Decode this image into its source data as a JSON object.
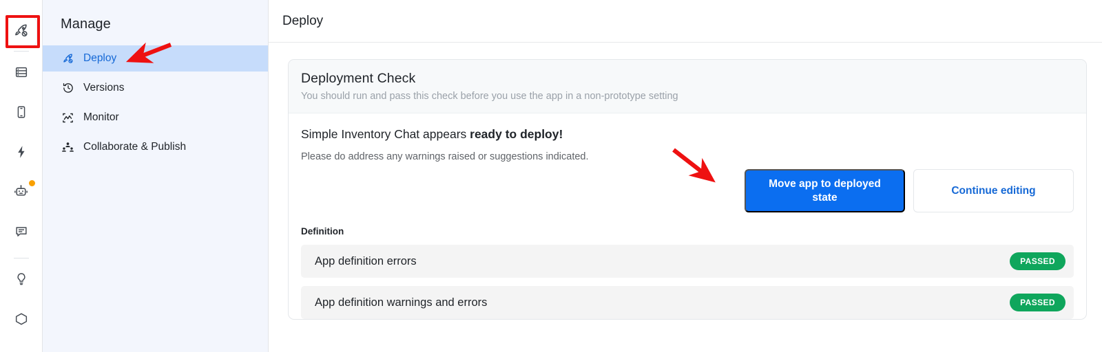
{
  "icon_rail": {
    "items": [
      {
        "name": "rocket-icon",
        "label": "Deploy",
        "active": true,
        "badge": false
      },
      {
        "name": "database-icon",
        "label": "Data",
        "active": false,
        "badge": false
      },
      {
        "name": "mobile-icon",
        "label": "Preview",
        "active": false,
        "badge": false
      },
      {
        "name": "lightning-icon",
        "label": "Automations",
        "active": false,
        "badge": false
      },
      {
        "name": "robot-icon",
        "label": "Assistant",
        "active": false,
        "badge": true
      },
      {
        "name": "chat-icon",
        "label": "Chat",
        "active": false,
        "badge": false
      },
      {
        "name": "lightbulb-icon",
        "label": "Ideas",
        "active": false,
        "badge": false
      }
    ]
  },
  "sidebar": {
    "title": "Manage",
    "items": [
      {
        "label": "Deploy",
        "icon": "rocket-icon",
        "selected": true
      },
      {
        "label": "Versions",
        "icon": "history-icon",
        "selected": false
      },
      {
        "label": "Monitor",
        "icon": "monitor-chart-icon",
        "selected": false
      },
      {
        "label": "Collaborate & Publish",
        "icon": "people-icon",
        "selected": false
      }
    ]
  },
  "header": {
    "title": "Deploy"
  },
  "card": {
    "head_title": "Deployment Check",
    "head_subtitle": "You should run and pass this check before you use the app in a non-prototype setting",
    "status_prefix": "Simple Inventory Chat appears ",
    "status_strong": "ready to deploy!",
    "status_sub": "Please do address any warnings raised or suggestions indicated.",
    "primary_button": "Move app to deployed state",
    "secondary_button": "Continue editing",
    "section_label": "Definition",
    "checks": [
      {
        "label": "App definition errors",
        "status": "PASSED"
      },
      {
        "label": "App definition warnings and errors",
        "status": "PASSED"
      }
    ]
  },
  "colors": {
    "accent_blue": "#0b6ef0",
    "link_blue": "#1669d6",
    "selected_nav_bg": "#c6dcfb",
    "pass_green": "#0fa65c",
    "annotation_red": "#ee1111",
    "badge_orange": "#f9a000",
    "sidebar_bg": "#f3f6fd"
  },
  "annotations": {
    "highlight_box": "rocket-rail-icon-highlight",
    "arrow_to_deploy_nav": "arrow-pointing-to-deploy-nav-item",
    "arrow_to_deploy_button": "arrow-pointing-to-move-app-to-deployed-state-button"
  }
}
